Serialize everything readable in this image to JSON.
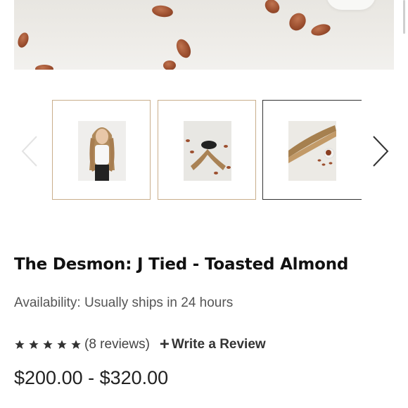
{
  "hero": {
    "alt": "product-hero-image"
  },
  "gallery": {
    "thumbnails": [
      {
        "name": "model-front"
      },
      {
        "name": "tied-extension-with-almonds"
      },
      {
        "name": "extension-with-almond-bowl"
      }
    ],
    "prev_icon": "chevron-left-icon",
    "next_icon": "chevron-right-icon"
  },
  "product": {
    "title": "The Desmon: J Tied - Toasted Almond",
    "availability_label": "Availability:",
    "availability_value": "Usually ships in 24 hours",
    "rating": {
      "stars": 5,
      "count_text": "(8 reviews)"
    },
    "write_review_plus": "+",
    "write_review_label": "Write a Review",
    "price_range": "$200.00 - $320.00"
  },
  "colors": {
    "thumb_border": "#c9ae8b",
    "thumb_active_border": "#333333",
    "star": "#333333"
  }
}
